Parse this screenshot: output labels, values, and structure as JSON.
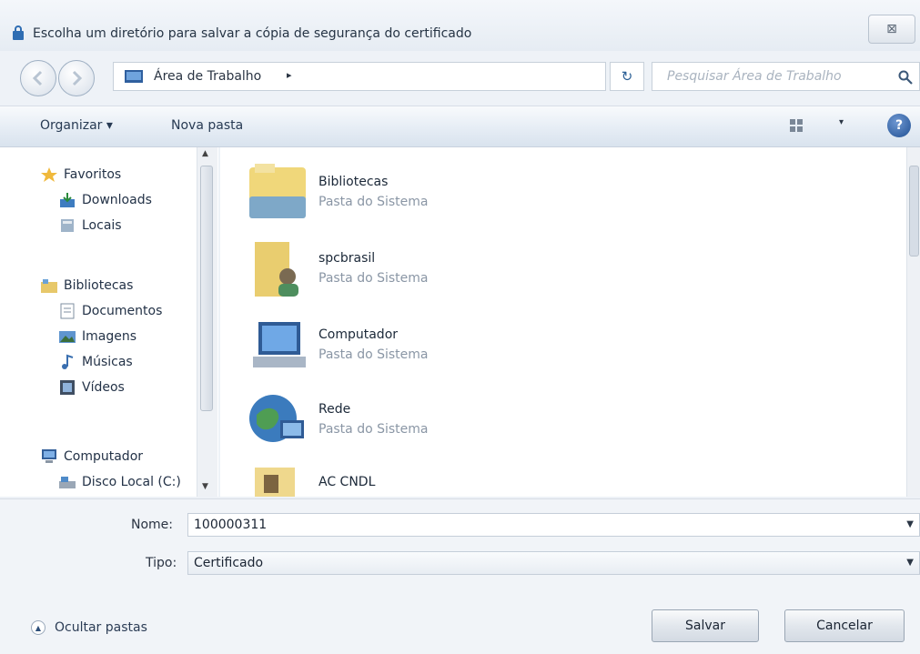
{
  "dialog": {
    "title": "Escolha um diretório para salvar a cópia de segurança do certificado",
    "close_label": "⊠"
  },
  "address": {
    "path": "Área de Trabalho",
    "separator": "▸",
    "dropdown": "▾",
    "refresh": "↻",
    "search_placeholder": "Pesquisar Área de Trabalho"
  },
  "toolbar": {
    "organize_label": "Organizar ▾",
    "new_folder_label": "Nova pasta",
    "view_arrow": "▾",
    "help_label": "?"
  },
  "sidebar": {
    "items": [
      {
        "label": "Favoritos",
        "icon": "star-icon"
      },
      {
        "label": "Downloads",
        "icon": "downloads-icon"
      },
      {
        "label": "Locais",
        "icon": "recent-places-icon"
      },
      {
        "label": "Bibliotecas",
        "icon": "libraries-icon"
      },
      {
        "label": "Documentos",
        "icon": "documents-icon"
      },
      {
        "label": "Imagens",
        "icon": "pictures-icon"
      },
      {
        "label": "Músicas",
        "icon": "music-icon"
      },
      {
        "label": "Vídeos",
        "icon": "videos-icon"
      },
      {
        "label": "Computador",
        "icon": "computer-icon"
      },
      {
        "label": "Disco Local (C:)",
        "icon": "drive-icon"
      }
    ]
  },
  "files": [
    {
      "name": "Bibliotecas",
      "type": "Pasta do Sistema",
      "icon": "libraries-folder-icon"
    },
    {
      "name": "spcbrasil",
      "type": "Pasta do Sistema",
      "icon": "user-folder-icon"
    },
    {
      "name": "Computador",
      "type": "Pasta do Sistema",
      "icon": "computer-icon"
    },
    {
      "name": "Rede",
      "type": "Pasta do Sistema",
      "icon": "network-icon"
    },
    {
      "name": "AC CNDL",
      "type": "",
      "icon": "folder-icon"
    }
  ],
  "form": {
    "name_label": "Nome:",
    "name_value": "100000311",
    "type_label": "Tipo:",
    "type_value": "Certificado"
  },
  "footer": {
    "hide_folders_label": "Ocultar pastas",
    "save_label": "Salvar",
    "cancel_label": "Cancelar"
  },
  "colors": {
    "accent": "#2b5f95",
    "window": "#eef2f7"
  }
}
